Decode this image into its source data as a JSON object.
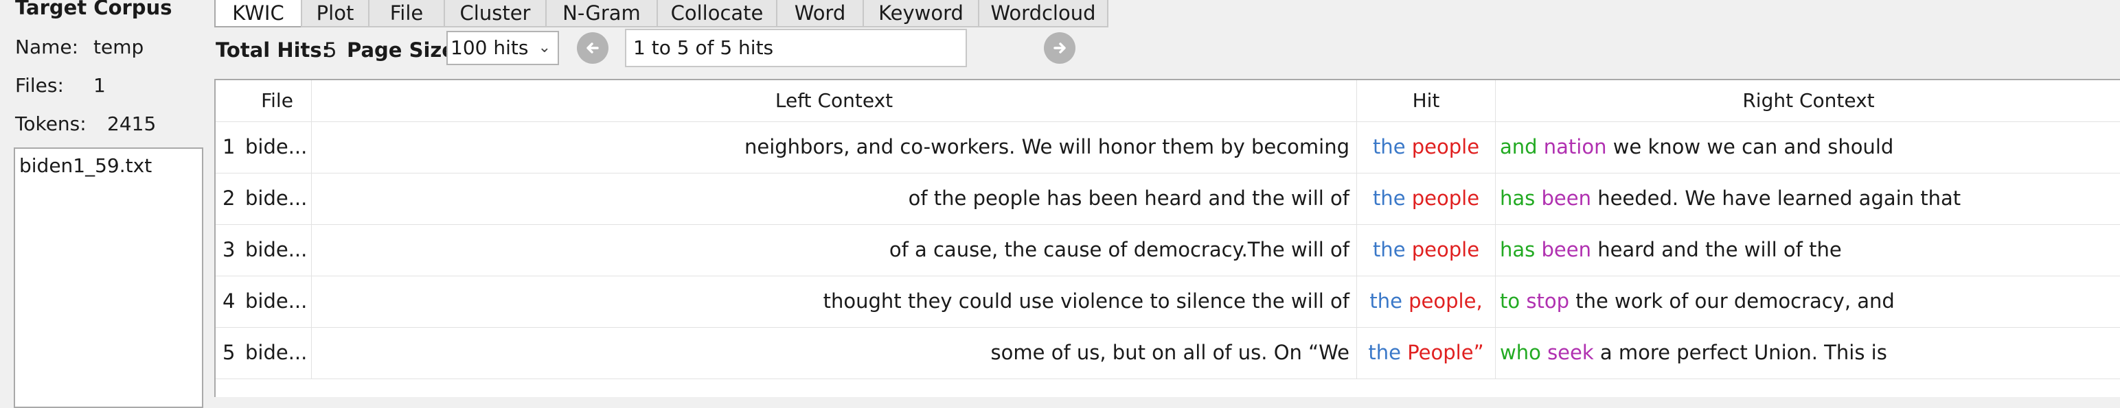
{
  "left_panel": {
    "title": "Target Corpus",
    "name_label": "Name:",
    "name_value": "temp",
    "files_label": "Files:",
    "files_value": "1",
    "tokens_label": "Tokens:",
    "tokens_value": "2415",
    "files": [
      "biden1_59.txt"
    ]
  },
  "tabs": [
    {
      "label": "KWIC",
      "active": true
    },
    {
      "label": "Plot"
    },
    {
      "label": "File"
    },
    {
      "label": "Cluster"
    },
    {
      "label": "N-Gram"
    },
    {
      "label": "Collocate"
    },
    {
      "label": "Word"
    },
    {
      "label": "Keyword"
    },
    {
      "label": "Wordcloud"
    }
  ],
  "toolbar": {
    "total_hits_label": "Total Hits:",
    "total_hits_value": "5",
    "page_size_label": "Page Size",
    "page_size_value": "100 hits",
    "prev_icon": "arrow-left-circle-icon",
    "next_icon": "arrow-right-circle-icon",
    "hits_range": "1 to 5 of 5 hits"
  },
  "table": {
    "headers": {
      "file": "File",
      "left": "Left Context",
      "hit": "Hit",
      "right": "Right Context"
    },
    "rows": [
      {
        "num": "1",
        "file": "bide...",
        "left": "neighbors, and co-workers. We will honor them by becoming",
        "hit1": "the",
        "hit2": "people",
        "r1": "and",
        "r2": "nation",
        "rest": "we know we can and should"
      },
      {
        "num": "2",
        "file": "bide...",
        "left": "of the people has been heard and the will of",
        "hit1": "the",
        "hit2": "people",
        "r1": "has",
        "r2": "been",
        "rest": "heeded. We have learned again that"
      },
      {
        "num": "3",
        "file": "bide...",
        "left": "of a cause, the cause of democracy.The will of",
        "hit1": "the",
        "hit2": "people",
        "r1": "has",
        "r2": "been",
        "rest": "heard and the will of the"
      },
      {
        "num": "4",
        "file": "bide...",
        "left": "thought they could use violence to silence the will of",
        "hit1": "the",
        "hit2": "people,",
        "r1": "to",
        "r2": "stop",
        "rest": "the work of our democracy, and"
      },
      {
        "num": "5",
        "file": "bide...",
        "left": "some of us, but on all of us. On “We",
        "hit1": "the",
        "hit2": "People”",
        "r1": "who",
        "r2": "seek",
        "rest": "a more perfect Union. This is"
      }
    ]
  },
  "colors": {
    "hit_the": "#3a78c8",
    "hit_word": "#e02020",
    "right_1": "#22aa22",
    "right_2": "#b030b0"
  }
}
